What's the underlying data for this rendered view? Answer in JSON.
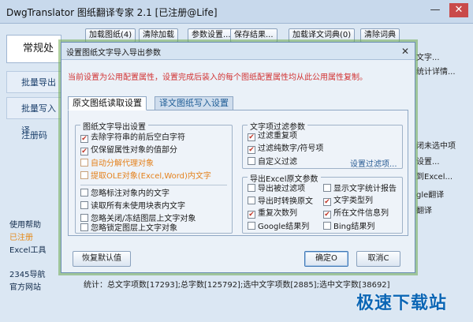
{
  "window": {
    "title": "DwgTranslator 图纸翻译专家 2.1 [已注册@Life]",
    "minimize_glyph": "—",
    "close_glyph": "✕"
  },
  "toolbar": {
    "buttons": [
      "加载图纸(4)",
      "清除加载",
      "参数设置...",
      "保存结果...",
      "加载译文词典(0)",
      "清除词典"
    ]
  },
  "sidebar": {
    "tabs": [
      "常规处",
      "批量导出原",
      "批量写入译",
      "注册码"
    ],
    "links": [
      "使用帮助",
      "已注册",
      "Excel工具",
      "2345导航",
      "官方网站"
    ]
  },
  "right_fragments": [
    "文字...",
    "统计详情...",
    "闭未选中项",
    "设置...",
    "到Excel...",
    "gle翻译",
    "翻译"
  ],
  "status": {
    "stats": "统计：总文字项数[17293];总字数[125792];选中文字项数[2885];选中文字数[38692]"
  },
  "watermark": "极速下载站",
  "dialog": {
    "title": "设置图纸文字导入导出参数",
    "close_glyph": "✕",
    "note": "当前设置为公用配置属性，设置完成后装入的每个图纸配置属性均从此公用属性复制。",
    "tabs": [
      "原文图纸读取设置",
      "译文图纸写入设置"
    ],
    "groups": {
      "export": {
        "title": "图纸文字导出设置",
        "items": [
          {
            "label": "去除字符串的前后空白字符",
            "checked": true,
            "style": "normal"
          },
          {
            "label": "仅保留属性对象的值部分",
            "checked": true,
            "style": "normal"
          },
          {
            "label": "自动分解代理对象",
            "checked": false,
            "style": "orange"
          },
          {
            "label": "提取OLE对象(Excel,Word)内文字",
            "checked": false,
            "style": "orange"
          },
          {
            "label": "忽略标注对象内的文字",
            "checked": false,
            "style": "normal"
          },
          {
            "label": "读取所有未使用块表内文字",
            "checked": false,
            "style": "normal"
          },
          {
            "label": "忽略关闭/冻结图层上文字对象",
            "checked": false,
            "style": "normal"
          },
          {
            "label": "忽略锁定图层上文字对象",
            "checked": false,
            "style": "normal"
          }
        ]
      },
      "filter": {
        "title": "文字项过滤参数",
        "items": [
          {
            "label": "过滤重复项",
            "checked": true
          },
          {
            "label": "过滤纯数字/符号项",
            "checked": true
          },
          {
            "label": "自定义过滤",
            "checked": false
          }
        ],
        "link": "设置过滤项..."
      },
      "excel": {
        "title": "导出Excel原文参数",
        "items": [
          {
            "label": "导出被过滤项",
            "checked": false
          },
          {
            "label": "显示文字统计报告",
            "checked": false
          },
          {
            "label": "导出时转换原文",
            "checked": false
          },
          {
            "label": "文字类型列",
            "checked": true
          },
          {
            "label": "重复次数列",
            "checked": true
          },
          {
            "label": "所在文件信息列",
            "checked": true
          },
          {
            "label": "Google结果列",
            "checked": false
          },
          {
            "label": "Bing结果列",
            "checked": false
          }
        ]
      }
    },
    "buttons": {
      "restore": "恢复默认值",
      "ok": "确定O",
      "cancel": "取消C"
    }
  },
  "colors": {
    "note_red": "#d23333",
    "orange_option": "#e4811c",
    "link_blue": "#2a5d95",
    "watermark_blue": "#0b66b5",
    "dialog_glow": "#6eaa50"
  },
  "icons": [
    "checkbox-icon",
    "close-icon",
    "minimize-icon"
  ]
}
